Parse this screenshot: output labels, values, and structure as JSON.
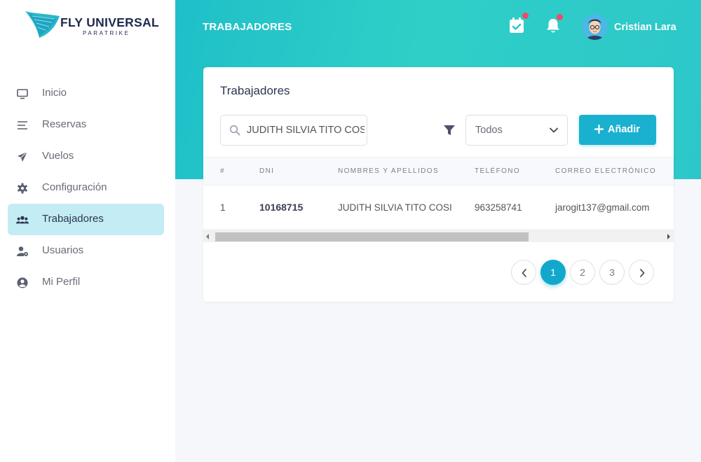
{
  "brand": {
    "title": "FLY UNIVERSAL",
    "subtitle": "PARATRIKE"
  },
  "sidebar": {
    "items": [
      {
        "label": "Inicio",
        "icon": "monitor-icon"
      },
      {
        "label": "Reservas",
        "icon": "list-icon"
      },
      {
        "label": "Vuelos",
        "icon": "paper-plane-icon"
      },
      {
        "label": "Configuración",
        "icon": "gear-icon"
      },
      {
        "label": "Trabajadores",
        "icon": "users-icon",
        "active": true
      },
      {
        "label": "Usuarios",
        "icon": "user-cog-icon"
      },
      {
        "label": "Mi Perfil",
        "icon": "user-circle-icon"
      }
    ]
  },
  "header": {
    "title": "TRABAJADORES",
    "user_name": "Cristian Lara",
    "icons": [
      "calendar-check-icon",
      "bell-icon"
    ]
  },
  "card": {
    "title": "Trabajadores",
    "search": {
      "value": "JUDITH SILVIA TITO COSI"
    },
    "filter": {
      "selected": "Todos"
    },
    "add_label": "Añadir"
  },
  "table": {
    "columns": [
      "#",
      "DNI",
      "NOMBRES Y APELLIDOS",
      "TELÉFONO",
      "CORREO ELECTRÓNICO"
    ],
    "rows": [
      {
        "index": "1",
        "dni": "10168715",
        "name": "JUDITH SILVIA TITO COSI",
        "phone": "963258741",
        "email": "jarogit137@gmail.com"
      }
    ]
  },
  "pagination": {
    "pages": [
      "1",
      "2",
      "3"
    ],
    "current": "1"
  },
  "colors": {
    "accent": "#19b1cf",
    "header_gradient_start": "#1fbfc9",
    "header_gradient_end": "#2dc7c9",
    "active_nav": "#c3ecf5",
    "notification_dot": "#f04a6b"
  }
}
